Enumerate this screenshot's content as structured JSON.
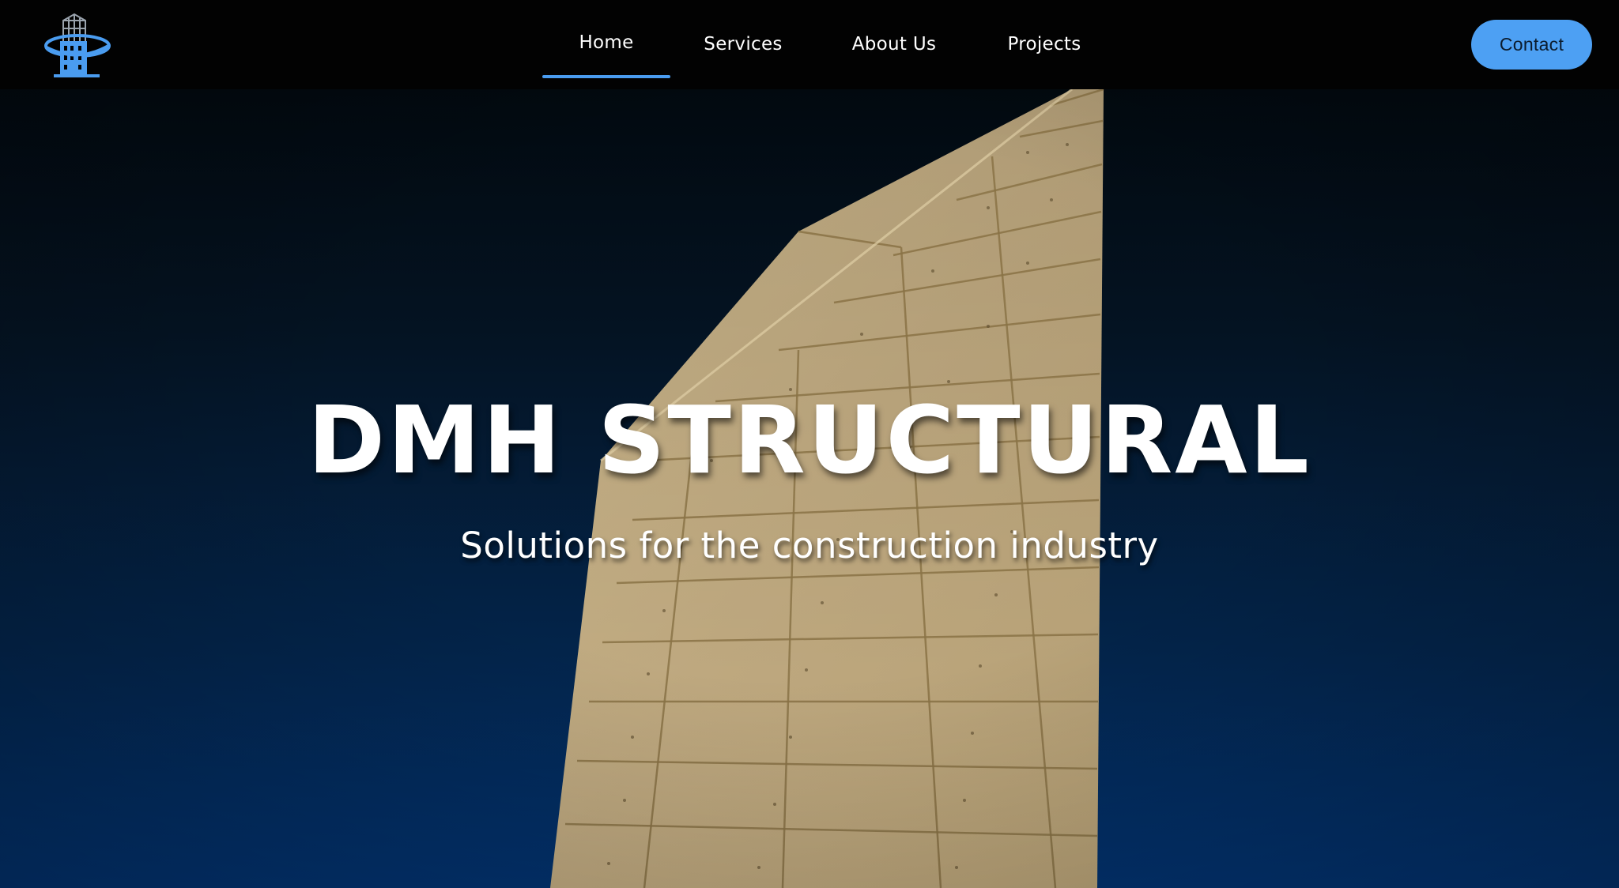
{
  "header": {
    "logo_icon": "building-logo-icon",
    "nav": [
      {
        "label": "Home",
        "active": true
      },
      {
        "label": "Services",
        "active": false
      },
      {
        "label": "About Us",
        "active": false
      },
      {
        "label": "Projects",
        "active": false
      }
    ],
    "contact_label": "Contact"
  },
  "hero": {
    "title": "DMH STRUCTURAL",
    "subtitle": "Solutions for the construction industry"
  },
  "colors": {
    "accent": "#4a9cf0",
    "header_bg": "#020202",
    "hero_top": "#02090f",
    "hero_bottom": "#023371",
    "concrete": "#c9b48a"
  }
}
